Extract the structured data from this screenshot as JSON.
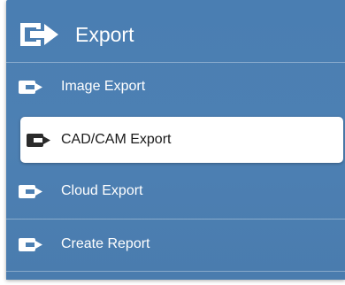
{
  "menu": {
    "title": "Export",
    "title_icon": "export-icon",
    "items": [
      {
        "label": "Image Export",
        "icon": "export-icon",
        "selected": false
      },
      {
        "label": "CAD/CAM Export",
        "icon": "export-icon",
        "selected": true
      },
      {
        "label": "Cloud Export",
        "icon": "export-icon",
        "selected": false
      },
      {
        "label": "Create Report",
        "icon": "export-icon",
        "selected": false
      }
    ]
  },
  "colors": {
    "panel_background": "#4d80b3",
    "selected_background": "#ffffff",
    "text_light": "#ffffff",
    "text_dark": "#1a1a1a",
    "icon_dark": "#2b2b2b"
  }
}
